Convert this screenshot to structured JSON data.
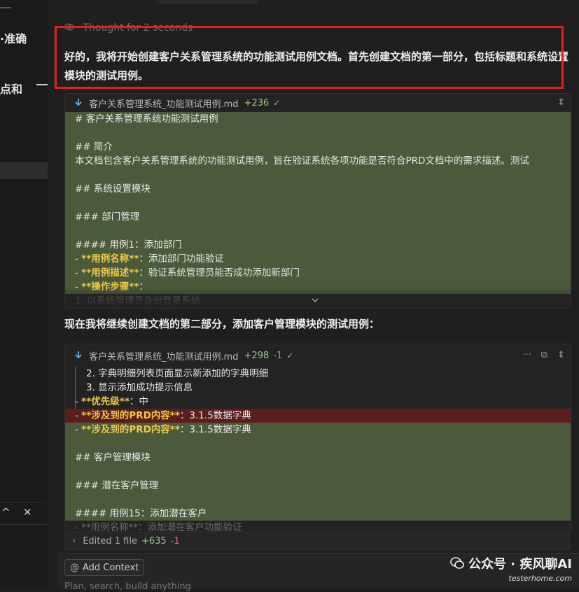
{
  "sidebar": {
    "fragment_1": "·准确",
    "fragment_2": "点和",
    "bottom_up": "^",
    "bottom_close": "✕"
  },
  "thought": {
    "label": "Thought for 2 seconds"
  },
  "intro_message": "好的，我将开始创建客户关系管理系统的功能测试用例文档。首先创建文档的第一部分，包括标题和系统设置模块的测试用例。",
  "card1": {
    "file_name": "客户关系管理系统_功能测试用例.md",
    "additions": "+236",
    "check": "✓",
    "lines": [
      {
        "type": "green",
        "prefix": "",
        "key": "",
        "text": "# 客户关系管理系统功能测试用例"
      },
      {
        "type": "green",
        "prefix": "",
        "key": "",
        "text": ""
      },
      {
        "type": "green",
        "prefix": "",
        "key": "",
        "text": "## 简介"
      },
      {
        "type": "green",
        "prefix": "",
        "key": "",
        "text": "本文档包含客户关系管理系统的功能测试用例，旨在验证系统各项功能是否符合PRD文档中的需求描述。测试"
      },
      {
        "type": "green",
        "prefix": "",
        "key": "",
        "text": ""
      },
      {
        "type": "green",
        "prefix": "",
        "key": "",
        "text": "## 系统设置模块"
      },
      {
        "type": "green",
        "prefix": "",
        "key": "",
        "text": ""
      },
      {
        "type": "green",
        "prefix": "",
        "key": "",
        "text": "### 部门管理"
      },
      {
        "type": "green",
        "prefix": "",
        "key": "",
        "text": ""
      },
      {
        "type": "green",
        "prefix": "",
        "key": "",
        "text": "#### 用例1：添加部门"
      },
      {
        "type": "green",
        "prefix": "- ",
        "key": "**用例名称**",
        "text": "：添加部门功能验证"
      },
      {
        "type": "green",
        "prefix": "- ",
        "key": "**用例描述**",
        "text": "：验证系统管理员能否成功添加新部门"
      },
      {
        "type": "green",
        "prefix": "- ",
        "key": "**操作步骤**",
        "text": "："
      },
      {
        "type": "faded",
        "prefix": "",
        "key": "",
        "text": "  1. 以系统管理员身份登录系统"
      }
    ]
  },
  "middle_message": "现在我将继续创建文档的第二部分，添加客户管理模块的测试用例：",
  "card2": {
    "file_name": "客户关系管理系统_功能测试用例.md",
    "additions": "+298",
    "deletions": "-1",
    "check": "✓",
    "menu": "···",
    "lines": [
      {
        "type": "plain",
        "indent": true,
        "prefix": "",
        "key": "",
        "text": "2. 字典明细列表页面显示新添加的字典明细"
      },
      {
        "type": "plain",
        "indent": true,
        "prefix": "",
        "key": "",
        "text": "3. 显示添加成功提示信息"
      },
      {
        "type": "plain",
        "indent": false,
        "prefix": "- ",
        "key": "**优先级**",
        "text": "：中"
      },
      {
        "type": "red",
        "indent": false,
        "prefix": "- ",
        "key": "**涉及到的PRD内容**",
        "text": "：3.1.5数据字典"
      },
      {
        "type": "green",
        "indent": false,
        "prefix": "- ",
        "key": "**涉及到的PRD内容**",
        "text": "：3.1.5数据字典"
      },
      {
        "type": "green",
        "indent": false,
        "prefix": "",
        "key": "",
        "text": ""
      },
      {
        "type": "green",
        "indent": false,
        "prefix": "",
        "key": "",
        "text": "## 客户管理模块"
      },
      {
        "type": "green",
        "indent": false,
        "prefix": "",
        "key": "",
        "text": ""
      },
      {
        "type": "green",
        "indent": false,
        "prefix": "",
        "key": "",
        "text": "### 潜在客户管理"
      },
      {
        "type": "green",
        "indent": false,
        "prefix": "",
        "key": "",
        "text": ""
      },
      {
        "type": "green",
        "indent": false,
        "prefix": "",
        "key": "",
        "text": "#### 用例15：添加潜在客户"
      },
      {
        "type": "faded",
        "indent": false,
        "prefix": "- ",
        "key": "",
        "text": "**用例名称**：添加潜在客户功能验证"
      }
    ]
  },
  "edited": {
    "label": "Edited 1 file",
    "additions": "+635",
    "deletions": "-1"
  },
  "composer": {
    "add_context": "Add Context",
    "placeholder": "Plan, search, build anything"
  },
  "watermark": {
    "line1": "公众号 · 疾风聊AI",
    "line2": "testerhome.com"
  },
  "colors": {
    "added_bg": "#4b5a3a",
    "removed_bg": "#5a1e1e",
    "highlight_border": "#e0211b",
    "keyword": "#f0c84a"
  }
}
